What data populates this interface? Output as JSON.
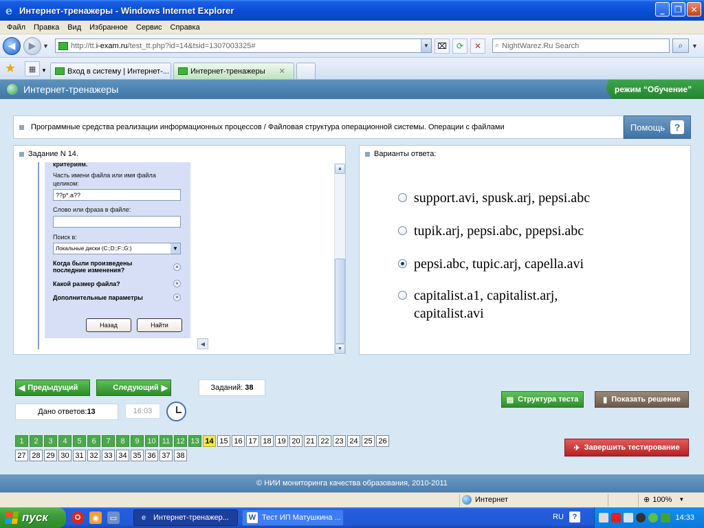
{
  "window": {
    "title": "Интернет-тренажеры - Windows Internet Explorer"
  },
  "menu": [
    "Файл",
    "Правка",
    "Вид",
    "Избранное",
    "Сервис",
    "Справка"
  ],
  "address": {
    "url_prefix": "http://tt.",
    "url_domain": "i-exam.ru",
    "url_rest": "/test_tt.php?id=14&tsid=1307003325#",
    "search_placeholder": "NightWarez.Ru Search"
  },
  "tabs": [
    {
      "label": "Вход в систему | Интернет-...",
      "active": false
    },
    {
      "label": "Интернет-тренажеры",
      "active": true
    }
  ],
  "page": {
    "header_title": "Интернет-тренажеры",
    "mode_label": "режим “Обучение”",
    "breadcrumb": "Программные средства реализации информационных процессов / Файловая структура операционной системы. Операции с файлами",
    "help_label": "Помощь",
    "task_title": "Задание N 14.",
    "answers_title": "Варианты ответа:"
  },
  "dialog": {
    "criteria": "критериям.",
    "name_label_1": "Часть имени файла или имя файла",
    "name_label_2": "целиком:",
    "name_value": "??p*.a??",
    "phrase_label": "Слово или фраза в файле:",
    "search_in_label": "Поиск в:",
    "search_in_value": "Локальные диски (C:;D:;F:;G:)",
    "changed_1": "Когда были произведены",
    "changed_2": "последние изменения?",
    "size": "Какой размер файла?",
    "advanced": "Дополнительные параметры",
    "back": "Назад",
    "find": "Найти"
  },
  "options": [
    {
      "text": "support.avi, spusk.arj, pepsi.abc",
      "selected": false
    },
    {
      "text": "tupik.arj, pepsi.abc, ppepsi.abc",
      "selected": false
    },
    {
      "text": "pepsi.abc, tupic.arj, capella.avi",
      "selected": true
    },
    {
      "line1": "capitalist.a1, capitalist.arj,",
      "line2": "capitalist.avi",
      "selected": false
    }
  ],
  "nav": {
    "prev": "Предыдущий",
    "next": "Следующий",
    "tasks_label": "Заданий:",
    "tasks_count": "38",
    "answers_label": "Дано ответов:",
    "answers_count": "13",
    "time": "16:03",
    "structure": "Структура теста",
    "show_solution": "Показать решение",
    "finish": "Завершить тестирование"
  },
  "question_grid": {
    "answered_through": 13,
    "current": 14,
    "row1": [
      "1",
      "2",
      "3",
      "4",
      "5",
      "6",
      "7",
      "8",
      "9",
      "10",
      "11",
      "12",
      "13",
      "14",
      "15",
      "16",
      "17",
      "18",
      "19",
      "20",
      "21",
      "22",
      "23",
      "24",
      "25",
      "26"
    ],
    "row2": [
      "27",
      "28",
      "29",
      "30",
      "31",
      "32",
      "33",
      "34",
      "35",
      "36",
      "37",
      "38"
    ]
  },
  "footer": "© НИИ мониторинга качества образования, 2010-2011",
  "status": {
    "zone": "Интернет",
    "zoom": "100%"
  },
  "taskbar": {
    "start": "пуск",
    "tasks": [
      {
        "label": "Интернет-тренажер...",
        "active": true
      },
      {
        "label": "Тест ИП Матушкина ...",
        "active": false
      }
    ],
    "lang": "RU",
    "clock": "14:33"
  },
  "colors": {
    "title_blue": "#0a4fd6",
    "header_blue": "#4a7eae",
    "answered_green": "#4ca94b",
    "current_yellow": "#f1e94a",
    "finish_red": "#b52222"
  }
}
